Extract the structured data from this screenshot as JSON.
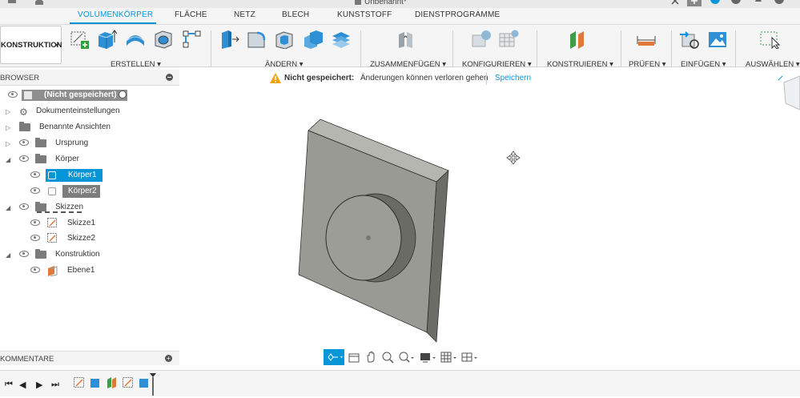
{
  "window": {
    "title": "Unbenannt*"
  },
  "workspace": {
    "label": "KONSTRUKTION"
  },
  "tabs": [
    {
      "label": "VOLUMENKÖRPER",
      "active": true
    },
    {
      "label": "FLÄCHE"
    },
    {
      "label": "NETZ"
    },
    {
      "label": "BLECH"
    },
    {
      "label": "KUNSTSTOFF"
    },
    {
      "label": "DIENSTPROGRAMME"
    }
  ],
  "groups": [
    {
      "label": "ERSTELLEN"
    },
    {
      "label": "ÄNDERN"
    },
    {
      "label": "ZUSAMMENFÜGEN"
    },
    {
      "label": "KONFIGURIEREN"
    },
    {
      "label": "KONSTRUIEREN"
    },
    {
      "label": "PRÜFEN"
    },
    {
      "label": "EINFÜGEN"
    },
    {
      "label": "AUSWÄHLEN"
    }
  ],
  "browser": {
    "title": "BROWSER",
    "root": "(Nicht gespeichert)",
    "items": [
      {
        "label": "Dokumenteinstellungen"
      },
      {
        "label": "Benannte Ansichten"
      },
      {
        "label": "Ursprung"
      },
      {
        "label": "Körper"
      },
      {
        "label": "Körper1"
      },
      {
        "label": "Körper2"
      },
      {
        "label": "Skizzen"
      },
      {
        "label": "Skizze1"
      },
      {
        "label": "Skizze2"
      },
      {
        "label": "Konstruktion"
      },
      {
        "label": "Ebene1"
      }
    ]
  },
  "banner": {
    "status": "Nicht gespeichert:",
    "message": "Änderungen können verloren gehen",
    "action": "Speichern"
  },
  "comments": {
    "title": "KOMMENTARE"
  },
  "colors": {
    "accent": "#0696d7",
    "warning": "#f0a30a"
  }
}
